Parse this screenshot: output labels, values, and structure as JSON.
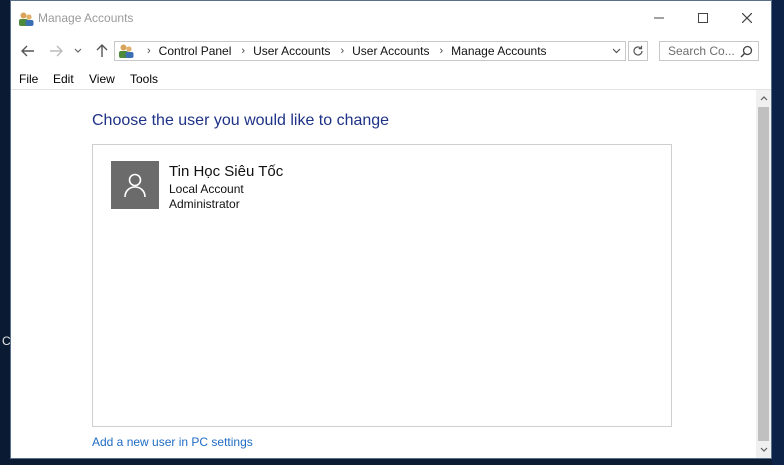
{
  "window": {
    "title": "Manage Accounts"
  },
  "navigation": {
    "breadcrumbs": [
      "Control Panel",
      "User Accounts",
      "User Accounts",
      "Manage Accounts"
    ],
    "search_placeholder": "Search Co..."
  },
  "menu": {
    "items": [
      "File",
      "Edit",
      "View",
      "Tools"
    ]
  },
  "main": {
    "heading": "Choose the user you would like to change",
    "accounts": [
      {
        "name": "Tin Học Siêu Tốc",
        "type": "Local Account",
        "role": "Administrator"
      }
    ],
    "add_user_link": "Add a new user in PC settings"
  },
  "desktop": {
    "stray_text": "C"
  },
  "colors": {
    "heading": "#1e3287",
    "link": "#1f6cc4",
    "avatar_bg": "#6b6b6b"
  }
}
